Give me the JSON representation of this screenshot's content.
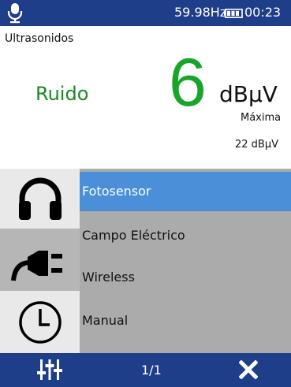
{
  "status_bar": {
    "mic_icon": "microphone-icon",
    "frequency": "59.98Hz",
    "battery_icon": "battery-icon",
    "time": "00:23"
  },
  "measurement": {
    "mode_title": "Ultrasonidos",
    "status_label": "Ruido",
    "value": "6",
    "unit": "dBµV",
    "max_label": "Máxima",
    "max_value": "22 dBµV",
    "value_color": "#18a62a"
  },
  "menu": {
    "icons": [
      "headphones-icon",
      "plug-icon",
      "clock-icon"
    ],
    "items": [
      {
        "label": "Fotosensor",
        "selected": true
      },
      {
        "label": "Campo Eléctrico",
        "selected": false
      },
      {
        "label": "Wireless",
        "selected": false
      },
      {
        "label": "Manual",
        "selected": false
      }
    ],
    "selected_color": "#4a8fd8"
  },
  "toolbar": {
    "settings_icon": "equalizer-sliders-icon",
    "page_indicator": "1/1",
    "close_icon": "close-icon",
    "bar_color": "#1f3e8a"
  }
}
